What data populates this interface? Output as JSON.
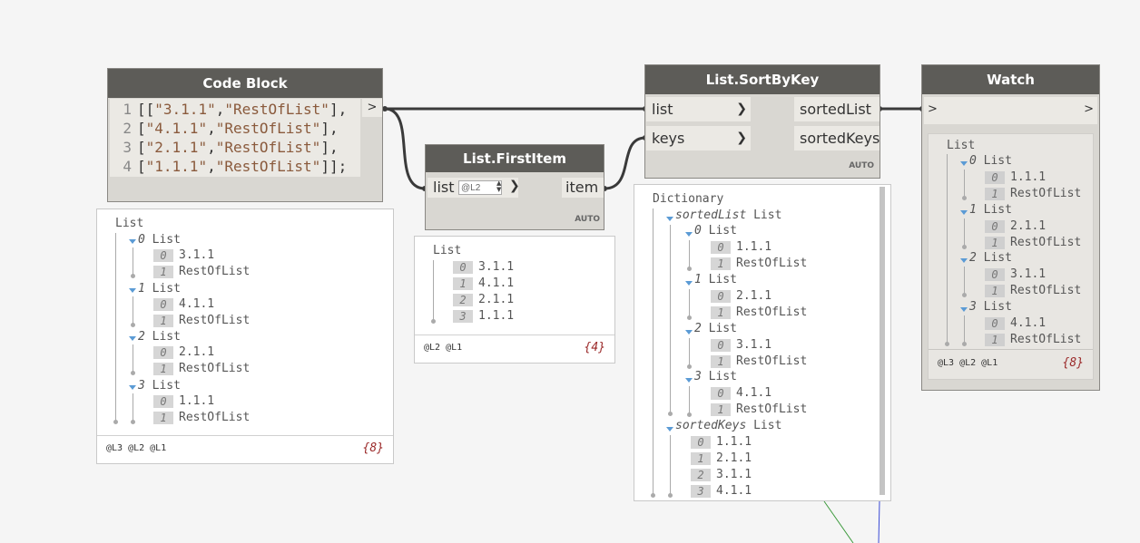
{
  "code_block": {
    "title": "Code Block",
    "output_port": ">",
    "line_numbers": [
      "1",
      "2",
      "3",
      "4"
    ],
    "lines": [
      {
        "open": "[[",
        "a": "\"3.1.1\"",
        "comma": ",",
        "b": "\"RestOfList\"",
        "close": "],"
      },
      {
        "open": "[",
        "a": "\"4.1.1\"",
        "comma": ",",
        "b": "\"RestOfList\"",
        "close": "],"
      },
      {
        "open": "[",
        "a": "\"2.1.1\"",
        "comma": ",",
        "b": "\"RestOfList\"",
        "close": "],"
      },
      {
        "open": "[",
        "a": "\"1.1.1\"",
        "comma": ",",
        "b": "\"RestOfList\"",
        "close": "]];"
      }
    ],
    "preview": {
      "root": "List",
      "groups": [
        {
          "index": "0",
          "label": "List",
          "items": [
            [
              "0",
              "3.1.1"
            ],
            [
              "1",
              "RestOfList"
            ]
          ]
        },
        {
          "index": "1",
          "label": "List",
          "items": [
            [
              "0",
              "4.1.1"
            ],
            [
              "1",
              "RestOfList"
            ]
          ]
        },
        {
          "index": "2",
          "label": "List",
          "items": [
            [
              "0",
              "2.1.1"
            ],
            [
              "1",
              "RestOfList"
            ]
          ]
        },
        {
          "index": "3",
          "label": "List",
          "items": [
            [
              "0",
              "1.1.1"
            ],
            [
              "1",
              "RestOfList"
            ]
          ]
        }
      ],
      "levels": "@L3 @L2 @L1",
      "count": "{8}"
    }
  },
  "first_item": {
    "title": "List.FirstItem",
    "input_label": "list",
    "level_value": "@L2",
    "output_label": "item",
    "lacing": "AUTO",
    "preview": {
      "root": "List",
      "items": [
        [
          "0",
          "3.1.1"
        ],
        [
          "1",
          "4.1.1"
        ],
        [
          "2",
          "2.1.1"
        ],
        [
          "3",
          "1.1.1"
        ]
      ],
      "levels": "@L2 @L1",
      "count": "{4}"
    }
  },
  "sort_by_key": {
    "title": "List.SortByKey",
    "inputs": [
      "list",
      "keys"
    ],
    "outputs": [
      "sortedList",
      "sortedKeys"
    ],
    "lacing": "AUTO",
    "preview": {
      "root": "Dictionary",
      "sorted_list_key": "sortedList",
      "sorted_list_type": "List",
      "groups": [
        {
          "index": "0",
          "label": "List",
          "items": [
            [
              "0",
              "1.1.1"
            ],
            [
              "1",
              "RestOfList"
            ]
          ]
        },
        {
          "index": "1",
          "label": "List",
          "items": [
            [
              "0",
              "2.1.1"
            ],
            [
              "1",
              "RestOfList"
            ]
          ]
        },
        {
          "index": "2",
          "label": "List",
          "items": [
            [
              "0",
              "3.1.1"
            ],
            [
              "1",
              "RestOfList"
            ]
          ]
        },
        {
          "index": "3",
          "label": "List",
          "items": [
            [
              "0",
              "4.1.1"
            ],
            [
              "1",
              "RestOfList"
            ]
          ]
        }
      ],
      "sorted_keys_key": "sortedKeys",
      "sorted_keys_type": "List",
      "keys": [
        [
          "0",
          "1.1.1"
        ],
        [
          "1",
          "2.1.1"
        ],
        [
          "2",
          "3.1.1"
        ],
        [
          "3",
          "4.1.1"
        ]
      ]
    }
  },
  "watch": {
    "title": "Watch",
    "input_port": ">",
    "output_port": ">",
    "preview": {
      "root": "List",
      "groups": [
        {
          "index": "0",
          "label": "List",
          "items": [
            [
              "0",
              "1.1.1"
            ],
            [
              "1",
              "RestOfList"
            ]
          ]
        },
        {
          "index": "1",
          "label": "List",
          "items": [
            [
              "0",
              "2.1.1"
            ],
            [
              "1",
              "RestOfList"
            ]
          ]
        },
        {
          "index": "2",
          "label": "List",
          "items": [
            [
              "0",
              "3.1.1"
            ],
            [
              "1",
              "RestOfList"
            ]
          ]
        },
        {
          "index": "3",
          "label": "List",
          "items": [
            [
              "0",
              "4.1.1"
            ],
            [
              "1",
              "RestOfList"
            ]
          ]
        }
      ],
      "levels": "@L3 @L2 @L1",
      "count": "{8}"
    }
  },
  "colors": {
    "header": "#5d5c58",
    "node_body": "#d9d7d2",
    "wire": "#3a3a3a",
    "string_literal": "#8a5a3c",
    "count": "#9b2a2a",
    "expander": "#5b9bd5"
  }
}
